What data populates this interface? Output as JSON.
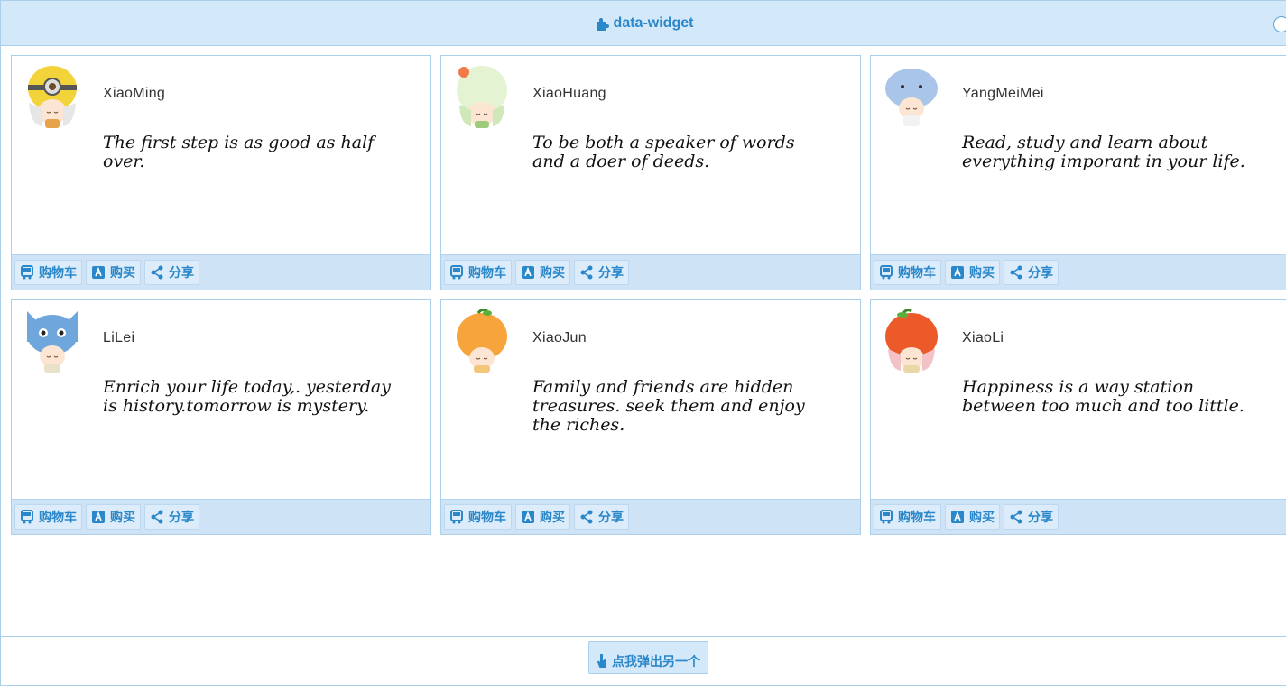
{
  "widget": {
    "title": "data-widget",
    "popup_label": "点我弹出另一个"
  },
  "colors": {
    "accent": "#2a87c9",
    "header_bg": "#d3e8f9",
    "border": "#a9cfe9",
    "action_bar_bg": "#cfe3f6"
  },
  "actions": {
    "cart": "购物车",
    "buy": "购买",
    "share": "分享"
  },
  "cards": [
    {
      "name": "XiaoMing",
      "quote": "The first step is as good as half over.",
      "avatar": "minion-hat-avatar"
    },
    {
      "name": "XiaoHuang",
      "quote": "To be both a speaker of words and a doer of deeds.",
      "avatar": "green-hat-avatar"
    },
    {
      "name": "YangMeiMei",
      "quote": "Read, study and learn about everything imporant in your life.",
      "avatar": "dolphin-hat-avatar"
    },
    {
      "name": "LiLei",
      "quote": "Enrich your life today,. yesterday is history.tomorrow is mystery.",
      "avatar": "blue-cat-hat-avatar"
    },
    {
      "name": "XiaoJun",
      "quote": "Family and friends are hidden treasures. seek them and enjoy the riches.",
      "avatar": "orange-hat-avatar"
    },
    {
      "name": "XiaoLi",
      "quote": "Happiness is a way station between too much and too little.",
      "avatar": "apple-hat-avatar"
    }
  ]
}
